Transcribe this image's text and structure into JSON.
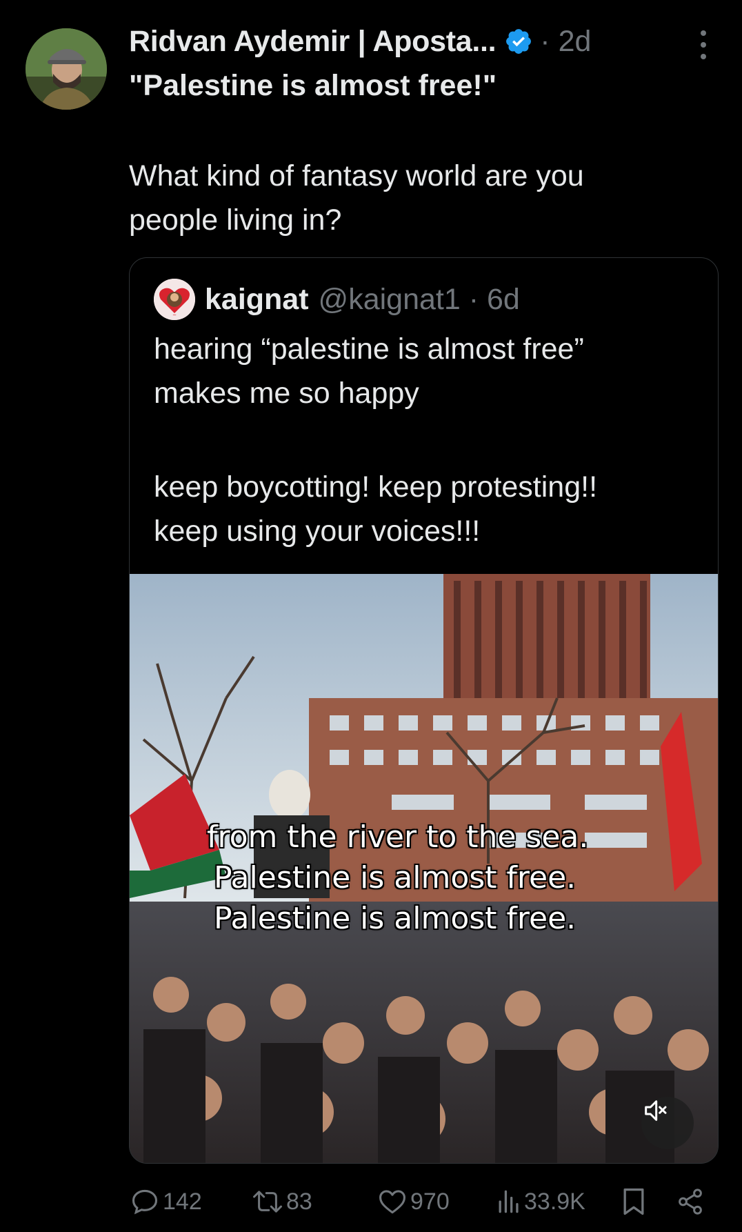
{
  "post": {
    "author_name": "Ridvan Aydemir | Aposta...",
    "age": "· 2d",
    "text_line1": "\"Palestine is almost free!\"",
    "text_line2": "What kind of fantasy world are you",
    "text_line3": "people living in?"
  },
  "quoted_post": {
    "name": "kaignat",
    "handle_age": "@kaignat1 · 6d",
    "text_line1": "hearing “palestine is almost free”",
    "text_line2": "makes me so happy",
    "text_line3": "keep boycotting! keep protesting!!",
    "text_line4": "keep using your voices!!!",
    "video_captions": [
      "from the river to the sea.",
      "Palestine is almost free.",
      "Palestine is almost free."
    ]
  },
  "actions": {
    "replies": "142",
    "reposts": "83",
    "likes": "970",
    "views": "33.9K"
  },
  "icons": {
    "verified": "verified-badge-icon",
    "more": "more-icon",
    "reply": "reply-icon",
    "repost": "repost-icon",
    "like": "heart-icon",
    "views": "views-icon",
    "bookmark": "bookmark-icon",
    "share": "share-icon",
    "mute": "muted-speaker-icon"
  },
  "colors": {
    "background": "#000000",
    "text": "#e7e9ea",
    "secondary": "#71767b",
    "verified": "#1d9bf0",
    "border": "#2f3336"
  }
}
